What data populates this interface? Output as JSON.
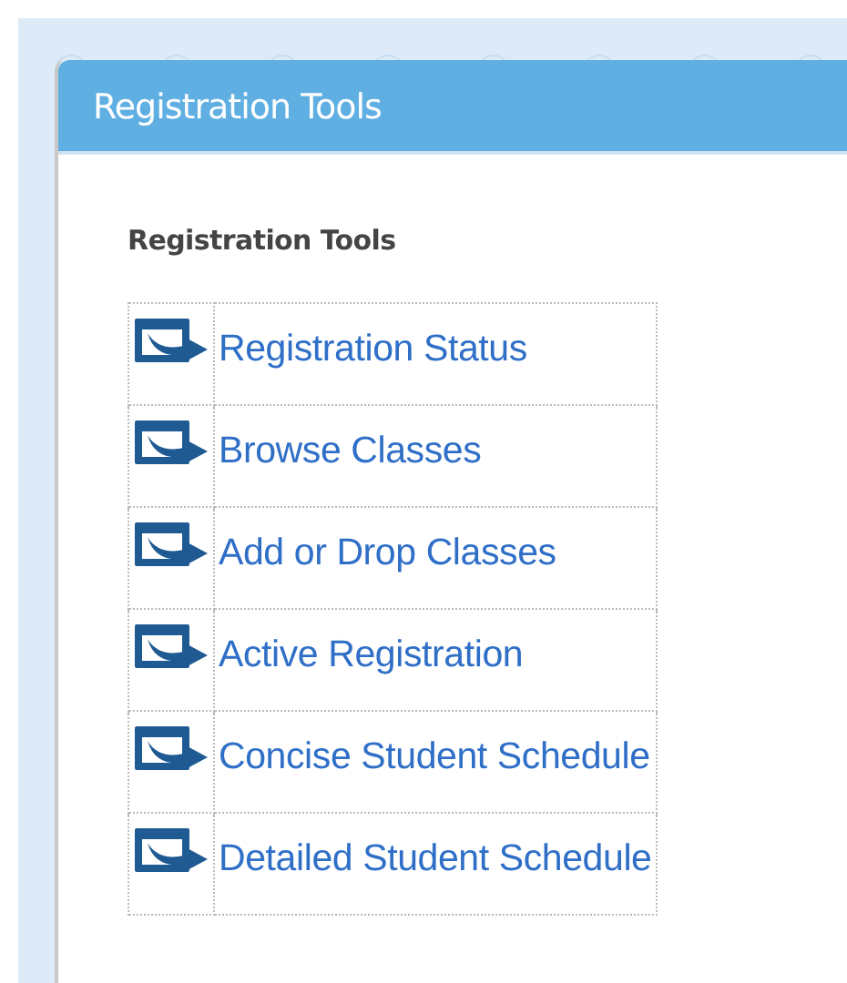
{
  "panel": {
    "title": "Registration Tools"
  },
  "section": {
    "heading": "Registration Tools"
  },
  "links": [
    {
      "label": "Registration Status"
    },
    {
      "label": "Browse Classes"
    },
    {
      "label": "Add or Drop Classes"
    },
    {
      "label": "Active Registration"
    },
    {
      "label": "Concise Student Schedule"
    },
    {
      "label": "Detailed Student Schedule"
    }
  ]
}
